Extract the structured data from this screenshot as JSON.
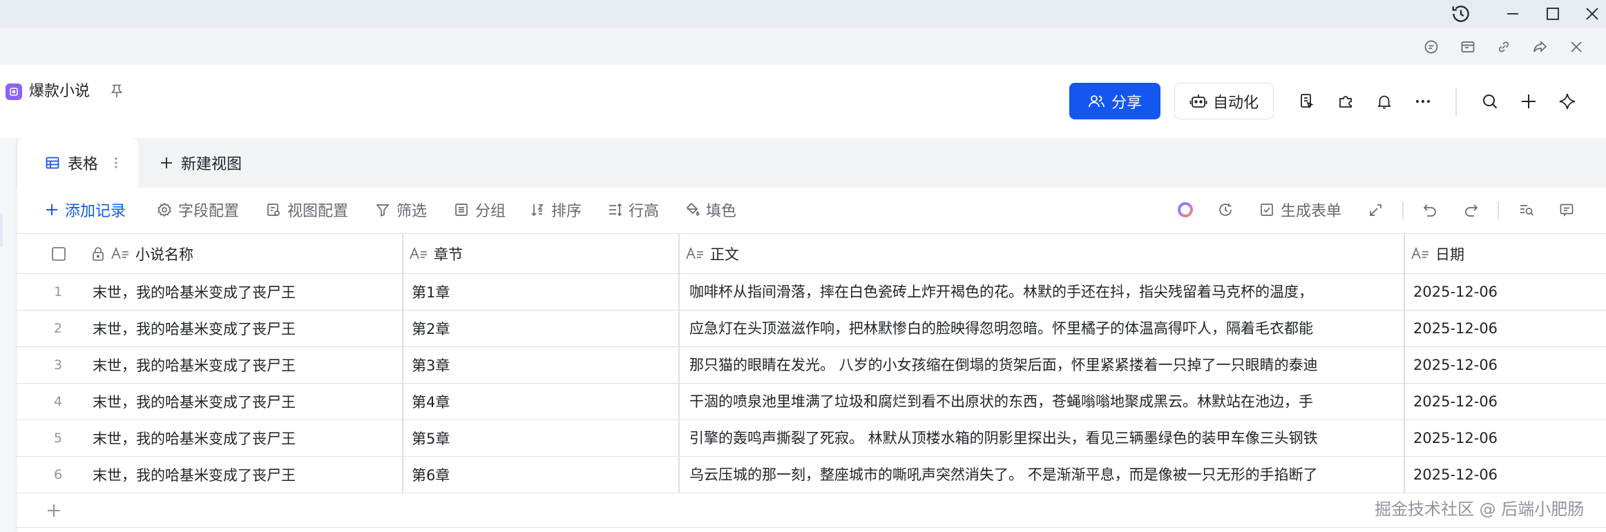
{
  "colors": {
    "accent": "#1456f0",
    "app_logo": "#8b62f5",
    "titlebar_bg": "#e6ecf1",
    "toolbar_text": "#646a73"
  },
  "window": {
    "icons": [
      "history-icon",
      "minimize-icon",
      "maximize-icon",
      "close-icon"
    ]
  },
  "subbar": {
    "icons": [
      "comment-icon",
      "layout-icon",
      "link-icon",
      "share-arrow-icon",
      "close-icon"
    ]
  },
  "header": {
    "doc_title": "爆款小说",
    "share_label": "分享",
    "automation_label": "自动化",
    "icons": [
      "doc-icon",
      "plugin-icon",
      "bell-icon",
      "more-icon",
      "search-icon",
      "plus-icon",
      "ai-sparkle-icon"
    ]
  },
  "tabs": {
    "active_label": "表格",
    "new_view_label": "新建视图"
  },
  "toolbar": {
    "add_record": "添加记录",
    "field_config": "字段配置",
    "view_config": "视图配置",
    "filter": "筛选",
    "group": "分组",
    "sort": "排序",
    "row_height": "行高",
    "fill_color": "填色",
    "generate_form": "生成表单"
  },
  "table": {
    "columns": [
      "小说名称",
      "章节",
      "正文",
      "日期"
    ],
    "rows": [
      {
        "index": "1",
        "name": "末世，我的哈基米变成了丧尸王",
        "chapter": "第1章",
        "body": "咖啡杯从指间滑落，摔在白色瓷砖上炸开褐色的花。林默的手还在抖，指尖残留着马克杯的温度，",
        "date": "2025-12-06"
      },
      {
        "index": "2",
        "name": "末世，我的哈基米变成了丧尸王",
        "chapter": "第2章",
        "body": "应急灯在头顶滋滋作响，把林默惨白的脸映得忽明忽暗。怀里橘子的体温高得吓人，隔着毛衣都能",
        "date": "2025-12-06"
      },
      {
        "index": "3",
        "name": "末世，我的哈基米变成了丧尸王",
        "chapter": "第3章",
        "body": "那只猫的眼睛在发光。 八岁的小女孩缩在倒塌的货架后面，怀里紧紧搂着一只掉了一只眼睛的泰迪",
        "date": "2025-12-06"
      },
      {
        "index": "4",
        "name": "末世，我的哈基米变成了丧尸王",
        "chapter": "第4章",
        "body": "干涸的喷泉池里堆满了垃圾和腐烂到看不出原状的东西，苍蝇嗡嗡地聚成黑云。林默站在池边，手",
        "date": "2025-12-06"
      },
      {
        "index": "5",
        "name": "末世，我的哈基米变成了丧尸王",
        "chapter": "第5章",
        "body": "引擎的轰鸣声撕裂了死寂。 林默从顶楼水箱的阴影里探出头，看见三辆墨绿色的装甲车像三头钢铁",
        "date": "2025-12-06"
      },
      {
        "index": "6",
        "name": "末世，我的哈基米变成了丧尸王",
        "chapter": "第6章",
        "body": "乌云压城的那一刻，整座城市的嘶吼声突然消失了。 不是渐渐平息，而是像被一只无形的手掐断了",
        "date": "2025-12-06"
      }
    ]
  },
  "watermark": "掘金技术社区 @ 后端小肥肠"
}
